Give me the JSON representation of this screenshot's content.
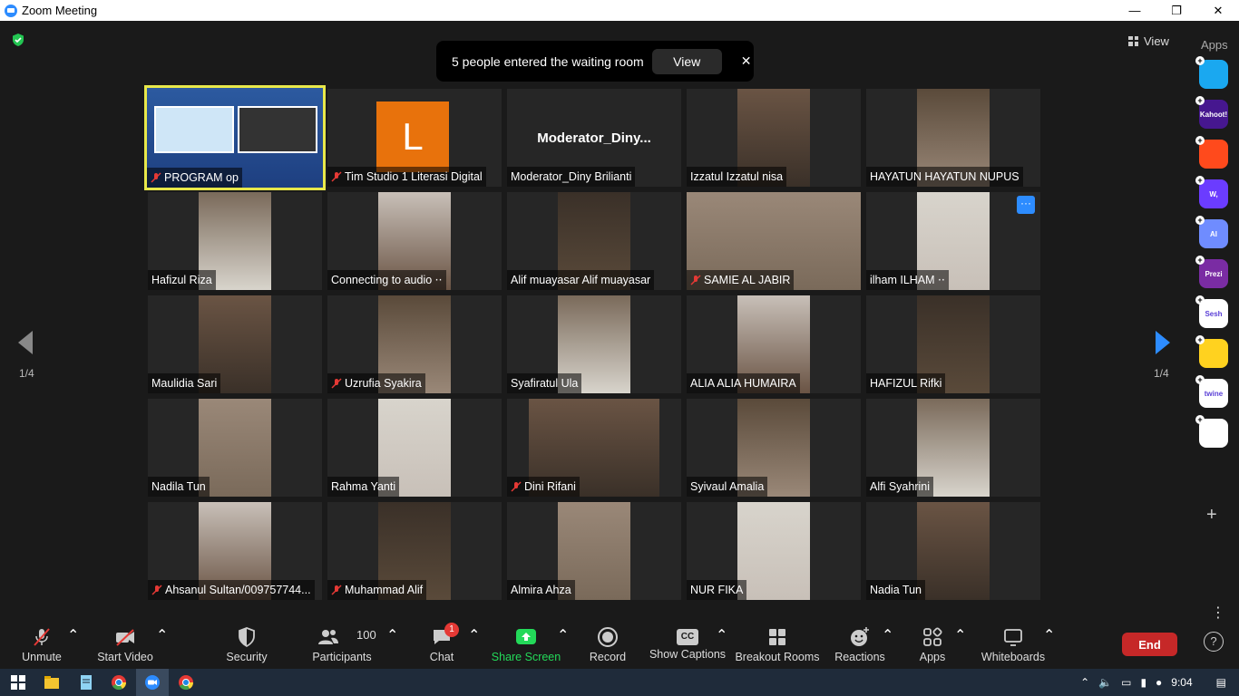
{
  "window": {
    "title": "Zoom Meeting",
    "controls": [
      "—",
      "❐",
      "✕"
    ]
  },
  "notification": {
    "text": "5 people entered the waiting room",
    "view_label": "View",
    "close": "✕"
  },
  "view_button": "View",
  "apps_label": "Apps",
  "pagination": {
    "left": "1/4",
    "right": "1/4"
  },
  "tiles": [
    {
      "name": "PROGRAM op",
      "muted": true
    },
    {
      "name": "Tim Studio 1 Literasi Digital",
      "muted": true,
      "avatar_letter": "L"
    },
    {
      "name": "Moderator_Diny Brilianti",
      "muted": false,
      "display": "Moderator_Diny..."
    },
    {
      "name": "Izzatul Izzatul nisa",
      "muted": false
    },
    {
      "name": "HAYATUN HAYATUN NUPUS",
      "muted": false
    },
    {
      "name": "Hafizul Riza",
      "muted": false
    },
    {
      "name": "Connecting to audio ⋅⋅",
      "muted": false
    },
    {
      "name": "Alif muayasar Alif muayasar",
      "muted": false
    },
    {
      "name": "SAMIE AL JABIR",
      "muted": true
    },
    {
      "name": "ilham ILHAM ⋅⋅",
      "muted": false,
      "more": "···"
    },
    {
      "name": "Maulidia Sari",
      "muted": false
    },
    {
      "name": "Uzrufia Syakira",
      "muted": true
    },
    {
      "name": "Syafiratul Ula",
      "muted": false
    },
    {
      "name": "ALIA ALIA HUMAIRA",
      "muted": false
    },
    {
      "name": "HAFIZUL Rifki",
      "muted": false
    },
    {
      "name": "Nadila Tun",
      "muted": false
    },
    {
      "name": "Rahma Yanti",
      "muted": false
    },
    {
      "name": "Dini Rifani",
      "muted": true
    },
    {
      "name": "Syivaul Amalia",
      "muted": false
    },
    {
      "name": "Alfi Syahrini",
      "muted": false
    },
    {
      "name": "Ahsanul Sultan/009757744...",
      "muted": true
    },
    {
      "name": "Muhammad Alif",
      "muted": true
    },
    {
      "name": "Almira Ahza",
      "muted": false
    },
    {
      "name": "NUR FIKA",
      "muted": false
    },
    {
      "name": "Nadia Tun",
      "muted": false
    }
  ],
  "apps_rail": [
    {
      "name": "pitch",
      "label": "",
      "color": "#1aa8f0"
    },
    {
      "name": "kahoot",
      "label": "Kahoot!",
      "color": "#46178f"
    },
    {
      "name": "miro-red",
      "label": "",
      "color": "#ff4a1c"
    },
    {
      "name": "wooclap",
      "label": "W,",
      "color": "#6b3cff"
    },
    {
      "name": "ai",
      "label": "AI",
      "color": "#6f8cff"
    },
    {
      "name": "prezi",
      "label": "Prezi",
      "color": "#7a2ca3"
    },
    {
      "name": "sesh",
      "label": "Sesh",
      "color": "#ffffff"
    },
    {
      "name": "emoji",
      "label": "",
      "color": "#ffd21f"
    },
    {
      "name": "twine",
      "label": "twine",
      "color": "#ffffff"
    },
    {
      "name": "blocks",
      "label": "",
      "color": "#ffffff"
    }
  ],
  "toolbar": {
    "unmute": "Unmute",
    "start_video": "Start Video",
    "security": "Security",
    "participants": "Participants",
    "participants_count": "100",
    "chat": "Chat",
    "chat_badge": "1",
    "share_screen": "Share Screen",
    "record": "Record",
    "show_captions": "Show Captions",
    "cc": "CC",
    "breakout_rooms": "Breakout Rooms",
    "reactions": "Reactions",
    "apps": "Apps",
    "whiteboards": "Whiteboards",
    "end": "End",
    "help": "?"
  },
  "taskbar": {
    "time": "9:04"
  },
  "colors": {
    "accent": "#2d8cff",
    "share": "#23d959",
    "end": "#c62828",
    "active_speaker": "#e8e84a"
  }
}
